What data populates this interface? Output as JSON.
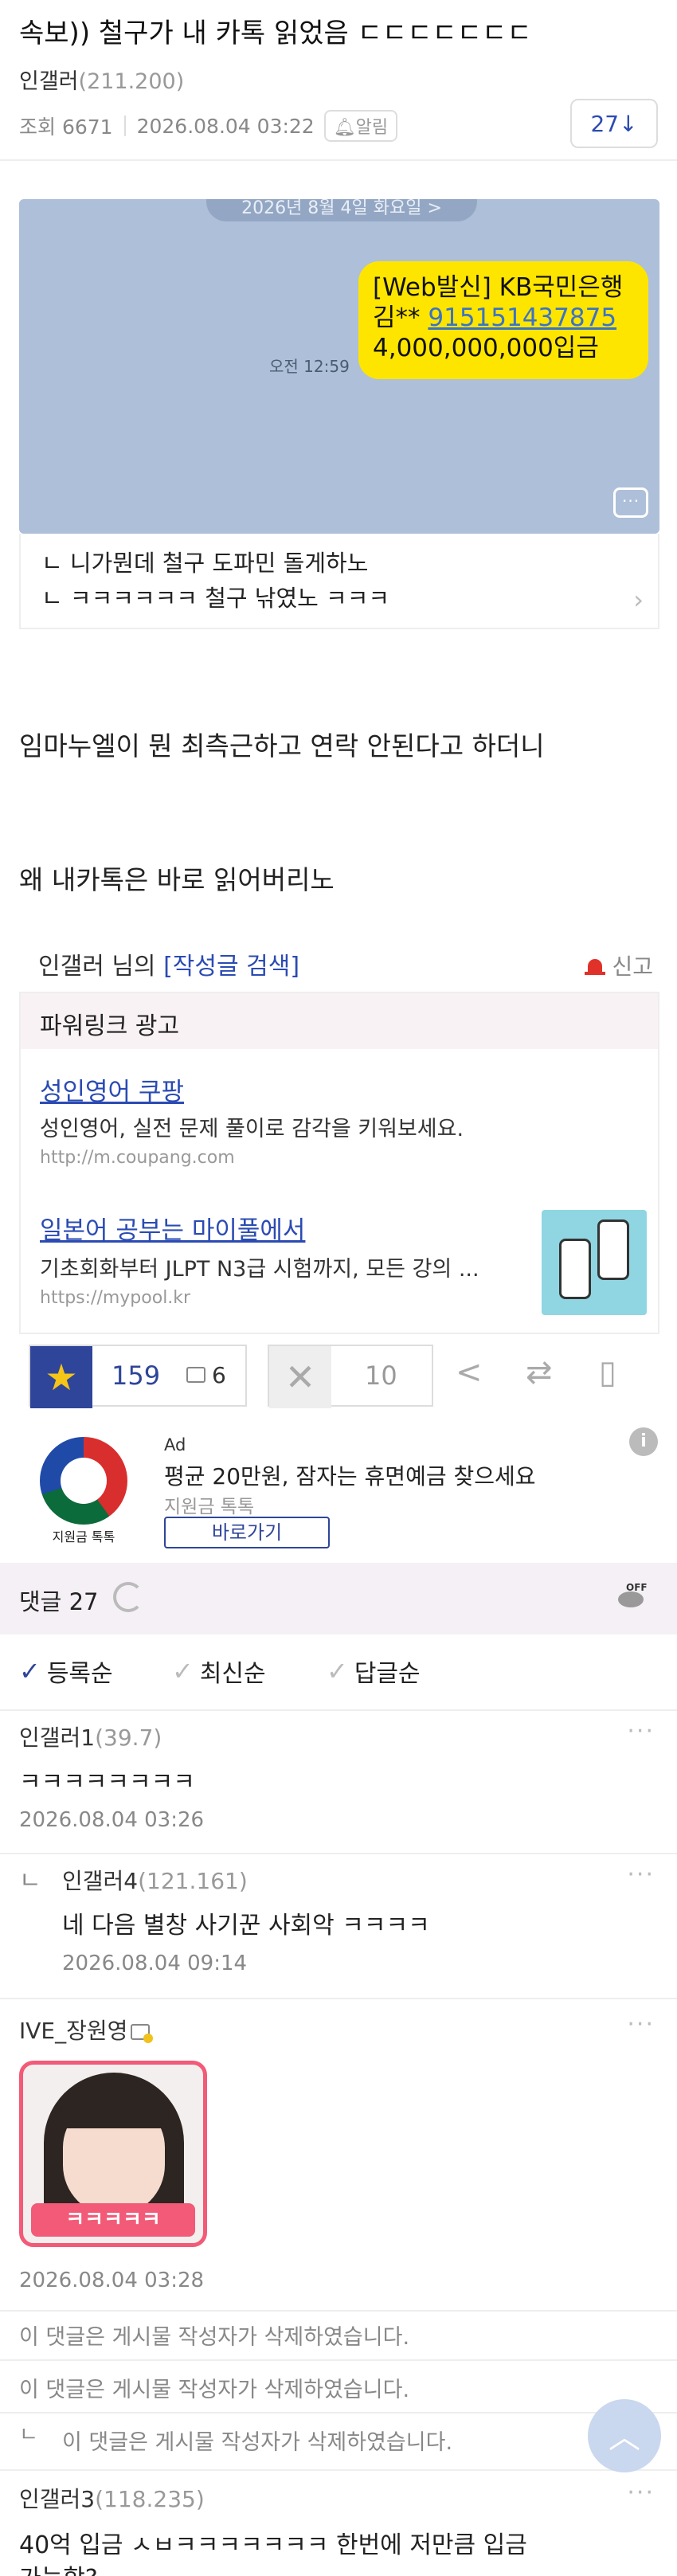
{
  "post": {
    "title": "속보)) 철구가 내 카톡 읽었음 ㄷㄷㄷㄷㄷㄷㄷ",
    "author": "인갤러",
    "author_ip": "(211.200)",
    "views_label": "조회 6671",
    "datetime": "2026.08.04 03:22",
    "alarm_label": "알림",
    "comment_count_button": "27↓"
  },
  "kakao_capture": {
    "date_pill": "2026년 8월 4일 화요일 >",
    "bubble_line1": "[Web발신] KB국민은행",
    "bubble_line2_prefix": "김** ",
    "bubble_account": "915151437875",
    "bubble_line3": "4,000,000,000입금",
    "time": "오전 12:59",
    "caption_line1": "ㄴ 니가뭔데 철구 도파민 돌게하노",
    "caption_line2": "ㄴ ㅋㅋㅋㅋㅋㅋ 철구 낚였노 ㅋㅋㅋ",
    "caption_chevron": "›"
  },
  "body": {
    "para1": "임마누엘이 뭔 최측근하고 연락 안된다고 하더니",
    "para2": "왜 내카톡은 바로 읽어버리노"
  },
  "author_search": {
    "prefix": "인갤러 님의 ",
    "link": "[작성글 검색]",
    "report": "신고"
  },
  "powerlink": {
    "header": "파워링크 광고",
    "ads": [
      {
        "title": "성인영어 쿠팡",
        "desc": "성인영어, 실전 문제 풀이로 감각을 키워보세요.",
        "url": "http://m.coupang.com"
      },
      {
        "title": "일본어 공부는 마이풀에서",
        "desc": "기초회화부터 JLPT N3급 시험까지, 모든 강의 ...",
        "url": "https://mypool.kr"
      }
    ]
  },
  "votes": {
    "star_icon": "★",
    "up": "159",
    "gonic": "6",
    "down_icon": "✕",
    "down": "10"
  },
  "native_ad": {
    "logo_caption": "지원금 톡톡",
    "tag": "Ad",
    "title": "평균 20만원, 잠자는 휴면예금 찾으세요",
    "sponsor": "지원금 톡톡",
    "cta": "바로가기",
    "info": "i"
  },
  "comments_bar": {
    "label": "댓글 27"
  },
  "sort": {
    "check": "✓",
    "options": [
      "등록순",
      "최신순",
      "답글순"
    ]
  },
  "comments": [
    {
      "name": "인갤러1",
      "ip": "(39.7)",
      "text": "ㅋㅋㅋㅋㅋㅋㅋㅋ",
      "date": "2026.08.04 03:26"
    },
    {
      "name": "인갤러4",
      "ip": "(121.161)",
      "text": "네 다음 별창 사기꾼 사회악 ㅋㅋㅋㅋ",
      "date": "2026.08.04 09:14",
      "reply_mark": "ㄴ"
    },
    {
      "name": "IVE_장원영",
      "ip": "",
      "text": "",
      "date": "2026.08.04 03:28",
      "sticker_text": "ㅋㅋㅋㅋㅋ"
    },
    {
      "name": "인갤러3",
      "ip": "(118.235)",
      "text": "40억 입금 ㅅㅂㅋㅋㅋㅋㅋㅋㅋ 한번에 저만큼 입금",
      "text2": "가능함?"
    }
  ],
  "deleted": {
    "d1": "이 댓글은 게시물 작성자가 삭제하였습니다.",
    "d2": "이 댓글은 게시물 작성자가 삭제하였습니다.",
    "d3": "이 댓글은 게시물 작성자가 삭제하였습니다.",
    "reply_mark": "ㄴ"
  },
  "more_label": "···",
  "scroll_top": "︿"
}
